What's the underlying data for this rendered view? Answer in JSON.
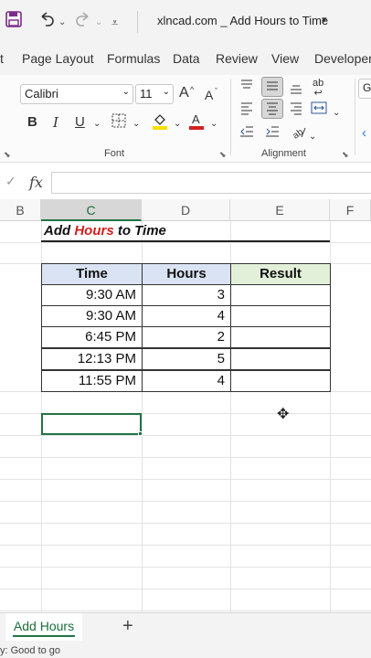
{
  "window": {
    "title": "xlncad.com _ Add Hours to Time",
    "title_caret": "▾",
    "qat": {
      "save_icon": "save-icon",
      "undo_icon": "undo-icon",
      "redo_icon": "redo-icon",
      "customize_icon": "chevron-down-icon"
    }
  },
  "ribbon_tabs": [
    "t",
    "Page Layout",
    "Formulas",
    "Data",
    "Review",
    "View",
    "Developer"
  ],
  "ribbon": {
    "font_name": "Calibri",
    "font_size": "11",
    "grow_font": "A",
    "shrink_font": "A",
    "bold": "B",
    "italic": "I",
    "underline": "U",
    "font_group_label": "Font",
    "alignment_group_label": "Alignment",
    "wrap_text": "ab",
    "next_group_partial": "G"
  },
  "formula_bar": {
    "fx": "fx",
    "check": "✓",
    "value": ""
  },
  "columns": [
    "B",
    "C",
    "D",
    "E",
    "F"
  ],
  "selected_column": "C",
  "sheet": {
    "heading_part1": "Add ",
    "heading_part2": "Hours",
    "heading_part3": " to Time",
    "headers": {
      "time": "Time",
      "hours": "Hours",
      "result": "Result"
    },
    "rows": [
      {
        "time": "9:30 AM",
        "hours": "3",
        "result": ""
      },
      {
        "time": "9:30 AM",
        "hours": "4",
        "result": ""
      },
      {
        "time": "6:45 PM",
        "hours": "2",
        "result": ""
      },
      {
        "time": "12:13 PM",
        "hours": "5",
        "result": ""
      },
      {
        "time": "11:55 PM",
        "hours": "4",
        "result": ""
      }
    ],
    "colors": {
      "header_blue": "#dae3f3",
      "header_green": "#e2f0d9",
      "heading_red": "#d42020",
      "accent": "#217346"
    }
  },
  "sheet_tabs": {
    "active": "Add Hours",
    "add": "+"
  },
  "status": {
    "text": "y: Good to go"
  }
}
